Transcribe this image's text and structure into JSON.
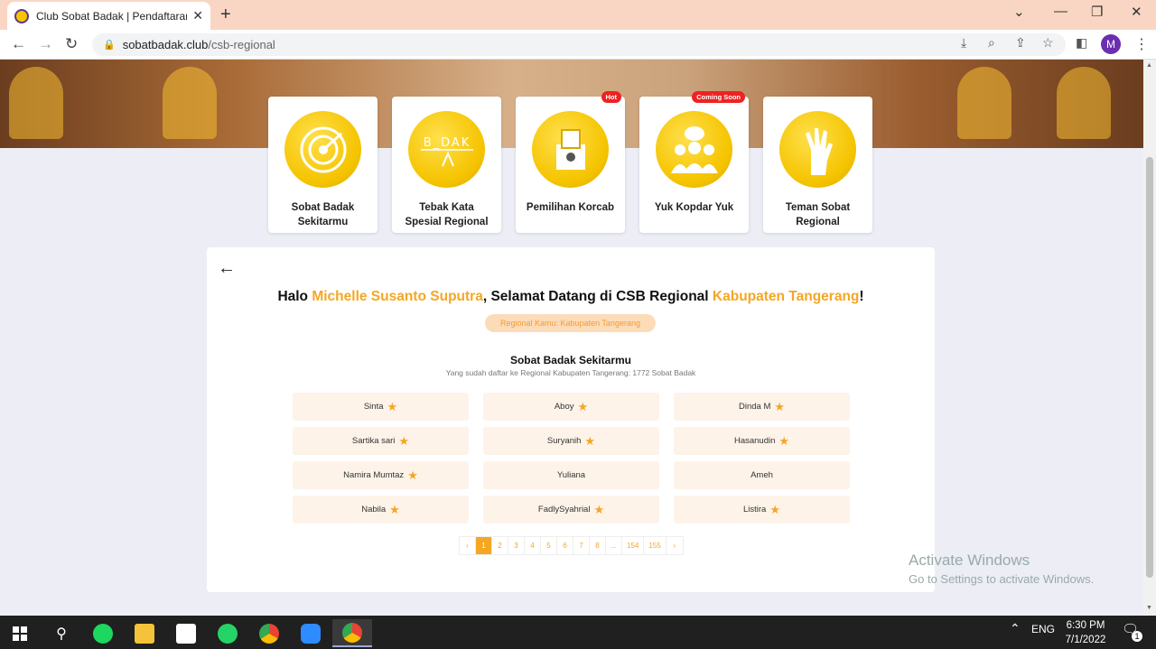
{
  "browser": {
    "tab_title": "Club Sobat Badak | Pendaftaran F",
    "new_tab": "+",
    "close_tab": "✕",
    "url_host": "sobatbadak.club",
    "url_path": "/csb-regional",
    "profile_initial": "M",
    "window_minimize": "—",
    "window_restore": "❐",
    "window_close": "✕",
    "tab_search": "⌄"
  },
  "menu_cards": [
    {
      "label": "Sobat Badak Sekitarmu",
      "badge": ""
    },
    {
      "label": "Tebak Kata Spesial Regional",
      "badge": ""
    },
    {
      "label": "Pemilihan Korcab",
      "badge": "Hot"
    },
    {
      "label": "Yuk Kopdar Yuk",
      "badge": "Coming Soon"
    },
    {
      "label": "Teman Sobat Regional",
      "badge": ""
    }
  ],
  "greeting": {
    "prefix": "Halo ",
    "name": "Michelle Susanto Suputra",
    "middle": ", Selamat Datang di CSB Regional ",
    "region": "Kabupaten Tangerang",
    "suffix": "!"
  },
  "region_pill": "Regional Kamu: Kabupaten Tangerang",
  "section": {
    "title": "Sobat Badak Sekitarmu",
    "subtitle": "Yang sudah daftar ke Regional Kabupaten Tangerang: 1772 Sobat Badak"
  },
  "members": [
    {
      "name": "Sinta",
      "star": true
    },
    {
      "name": "Aboy",
      "star": true
    },
    {
      "name": "Dinda M",
      "star": true
    },
    {
      "name": "Sartika sari",
      "star": true
    },
    {
      "name": "Suryanih",
      "star": true
    },
    {
      "name": "Hasanudin",
      "star": true
    },
    {
      "name": "Namira Mumtaz",
      "star": true
    },
    {
      "name": "Yuliana",
      "star": false
    },
    {
      "name": "Ameh",
      "star": false
    },
    {
      "name": "Nabila",
      "star": true
    },
    {
      "name": "FadlySyahrial",
      "star": true
    },
    {
      "name": "Listira",
      "star": true
    }
  ],
  "pagination": [
    "‹",
    "1",
    "2",
    "3",
    "4",
    "5",
    "6",
    "7",
    "8",
    "...",
    "154",
    "155",
    "›"
  ],
  "pagination_active": "1",
  "watermark": {
    "line1": "Activate Windows",
    "line2": "Go to Settings to activate Windows."
  },
  "taskbar": {
    "language": "ENG",
    "time": "6:30 PM",
    "date": "7/1/2022",
    "notification_count": "1"
  },
  "colors": {
    "accent": "#f5a623",
    "tabbar": "#f9d6c3",
    "badge_red": "#e22222",
    "card_yellow": "#f5c400"
  }
}
